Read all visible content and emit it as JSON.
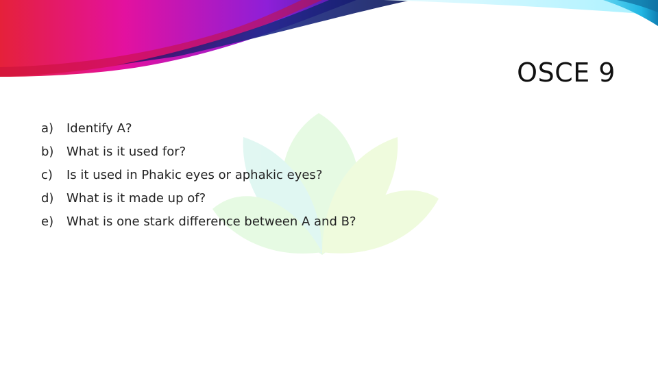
{
  "slide": {
    "title": "OSCE 9",
    "questions": [
      {
        "marker": "a)",
        "text": "Identify A?"
      },
      {
        "marker": "b)",
        "text": "What is it used for?"
      },
      {
        "marker": "c)",
        "text": "Is it used in Phakic eyes or aphakic eyes?"
      },
      {
        "marker": "d)",
        "text": "What is it made up of?"
      },
      {
        "marker": "e)",
        "text": "What is one stark difference between A and B?"
      }
    ]
  },
  "theme": {
    "accent_colors": [
      "#e5213a",
      "#e3119f",
      "#8e1fd8",
      "#1e2a8a",
      "#21b6e3",
      "#a8f1ff"
    ],
    "watermark_colors": [
      "#d7f7d2",
      "#cdf2ea",
      "#e6f9c8"
    ]
  }
}
